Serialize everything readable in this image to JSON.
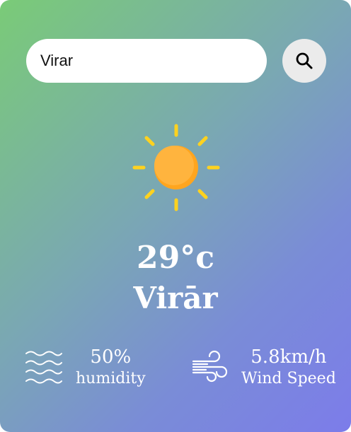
{
  "search": {
    "value": "Virar",
    "placeholder": ""
  },
  "weather": {
    "icon": "sun-icon",
    "temperature": "29°c",
    "city": "Virār"
  },
  "details": {
    "humidity": {
      "icon": "humidity-waves-icon",
      "value": "50%",
      "label": "humidity"
    },
    "wind": {
      "icon": "wind-icon",
      "value": "5.8km/h",
      "label": "Wind Speed"
    }
  },
  "colors": {
    "gradient_start": "#7acb77",
    "gradient_end": "#7c7cea",
    "sun_core": "#ffb13b",
    "sun_rays": "#ffd21f",
    "text": "#ffffff"
  }
}
